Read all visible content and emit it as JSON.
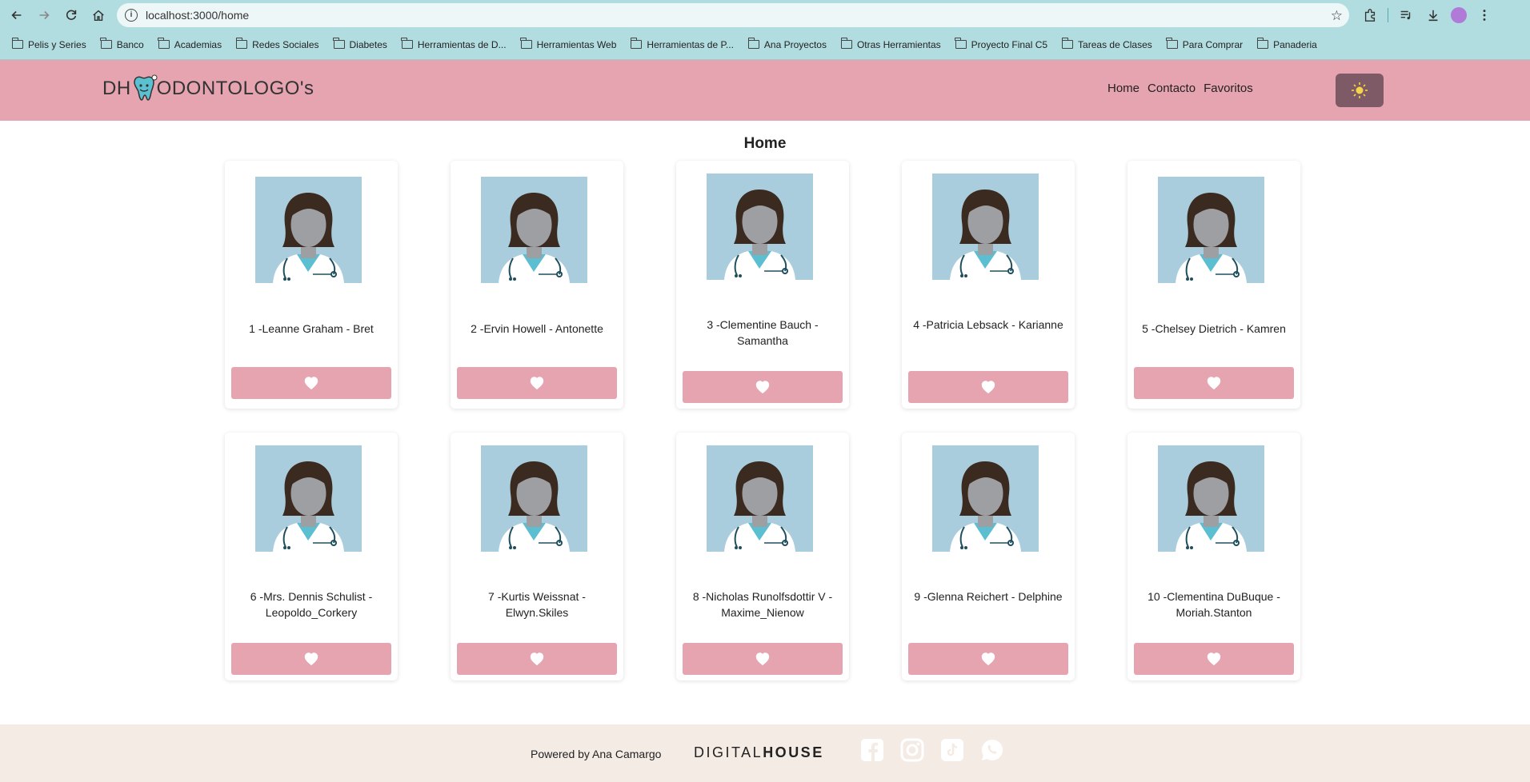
{
  "browser": {
    "url": "localhost:3000/home",
    "bookmarks": [
      "Pelis y Series",
      "Banco",
      "Academias",
      "Redes Sociales",
      "Diabetes",
      "Herramientas de D...",
      "Herramientas Web",
      "Herramientas de P...",
      "Ana Proyectos",
      "Otras Herramientas",
      "Proyecto Final C5",
      "Tareas de Clases",
      "Para Comprar",
      "Panaderia"
    ]
  },
  "header": {
    "logo_prefix": "DH",
    "logo_suffix": "ODONTOLOGO's",
    "nav": [
      "Home",
      "Contacto",
      "Favoritos"
    ]
  },
  "main": {
    "title": "Home",
    "dentists": [
      {
        "name": "1 -Leanne Graham - Bret"
      },
      {
        "name": "2 -Ervin Howell - Antonette"
      },
      {
        "name": "3 -Clementine Bauch - Samantha"
      },
      {
        "name": "4 -Patricia Lebsack - Karianne"
      },
      {
        "name": "5 -Chelsey Dietrich - Kamren"
      },
      {
        "name": "6 -Mrs. Dennis Schulist - Leopoldo_Corkery"
      },
      {
        "name": "7 -Kurtis Weissnat - Elwyn.Skiles"
      },
      {
        "name": "8 -Nicholas Runolfsdottir V - Maxime_Nienow"
      },
      {
        "name": "9 -Glenna Reichert - Delphine"
      },
      {
        "name": "10 -Clementina DuBuque - Moriah.Stanton"
      }
    ]
  },
  "footer": {
    "powered": "Powered by Ana Camargo",
    "brand_light": "DIGITAL",
    "brand_bold": "HOUSE",
    "social_icons": [
      "facebook-icon",
      "instagram-icon",
      "tiktok-icon",
      "whatsapp-icon"
    ]
  },
  "colors": {
    "accent": "#e6a3b0",
    "chrome": "#b2dde0",
    "avatar_bg": "#a9cddd",
    "footer_bg": "#f5ebe5"
  }
}
